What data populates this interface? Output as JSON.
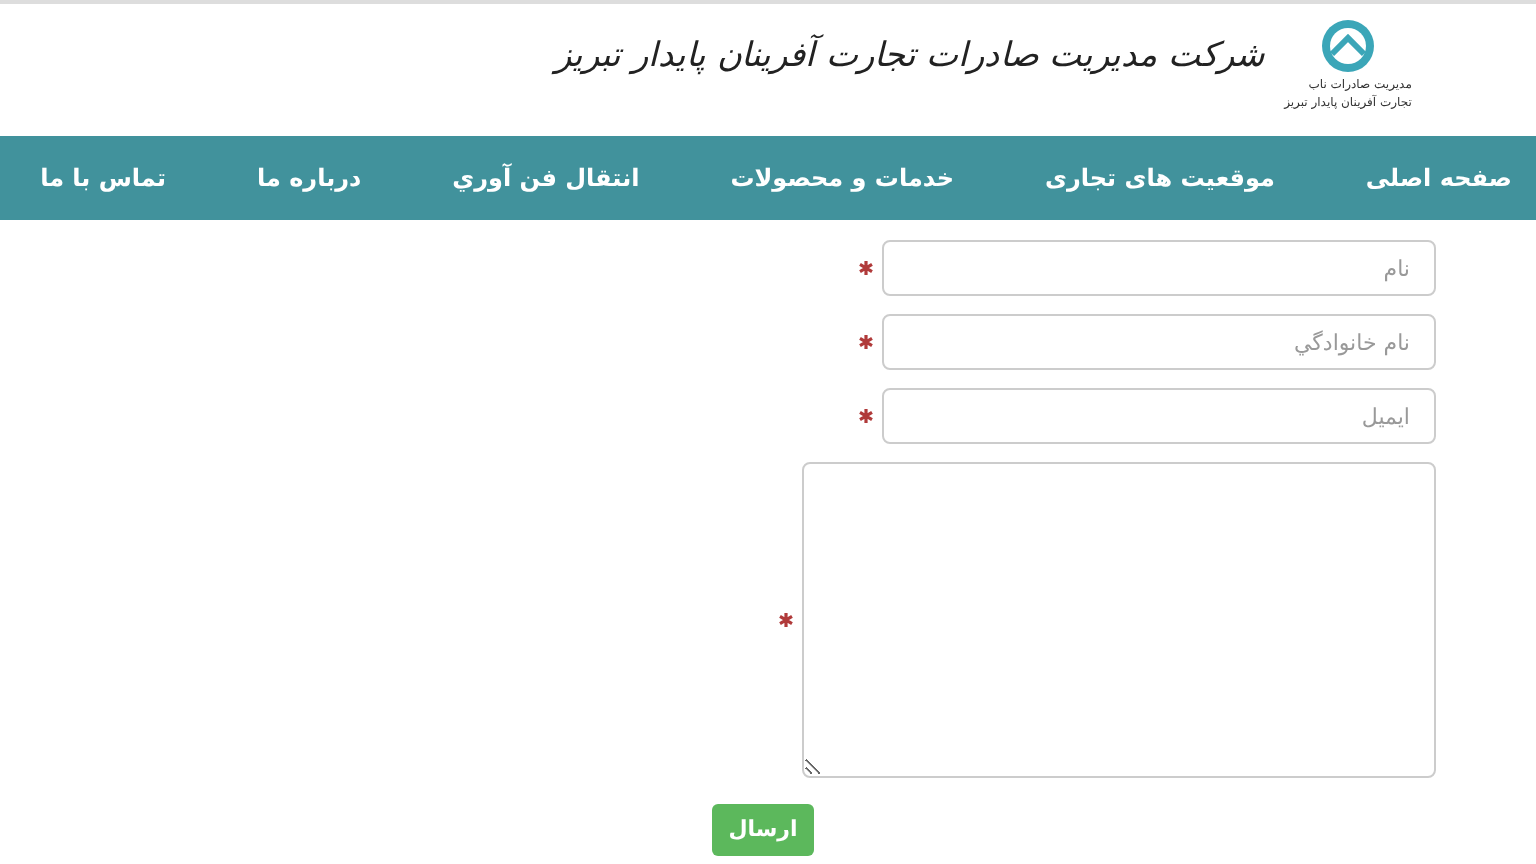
{
  "header": {
    "title": "شرکت مدیریت صادرات تجارت آفرینان پایدار تبریز",
    "logo_lines": [
      "مدیریت صادرات ناب",
      "تجارت آفرینان پایدار تبریز"
    ]
  },
  "nav": [
    {
      "label": "صفحه اصلی"
    },
    {
      "label": "موقعیت های تجاری"
    },
    {
      "label": "خدمات و محصولات"
    },
    {
      "label": "انتقال فن آوري"
    },
    {
      "label": "درباره ما"
    },
    {
      "label": "تماس با ما"
    }
  ],
  "form": {
    "fields": [
      {
        "kind": "input",
        "placeholder": "نام",
        "required": true
      },
      {
        "kind": "input",
        "placeholder": "نام خانوادگي",
        "required": true
      },
      {
        "kind": "input",
        "placeholder": "ایمیل",
        "required": true
      },
      {
        "kind": "textarea",
        "required": true
      }
    ],
    "submit": "ارسال"
  }
}
